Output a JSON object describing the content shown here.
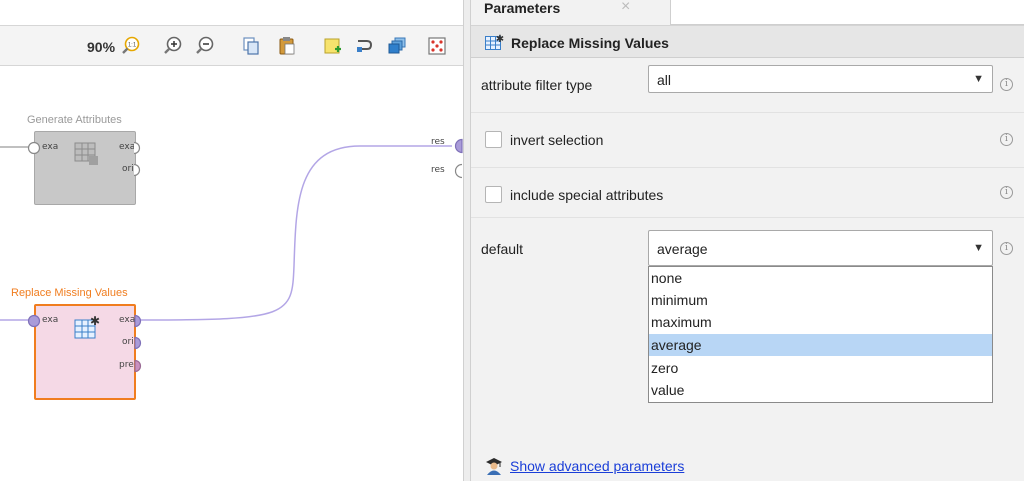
{
  "toolbar": {
    "zoom_level": "90%",
    "icons": [
      "zoom-fit-icon",
      "zoom-in-icon",
      "zoom-out-icon",
      "copy-icon",
      "paste-icon",
      "add-note-icon",
      "connect-icon",
      "layers-icon",
      "arrange-icon"
    ]
  },
  "canvas": {
    "generate_attributes": {
      "title": "Generate Attributes",
      "in_ports": [
        "exa"
      ],
      "out_ports": [
        "exa",
        "ori"
      ]
    },
    "replace_missing_values": {
      "title": "Replace Missing Values",
      "in_ports": [
        "exa"
      ],
      "out_ports": [
        "exa",
        "ori",
        "pre"
      ]
    },
    "result_ports": [
      "res",
      "res"
    ]
  },
  "params_tab": {
    "label": "Parameters",
    "close": "×"
  },
  "operator": {
    "title": "Replace Missing Values"
  },
  "params": {
    "attribute_filter_type": {
      "label": "attribute filter type",
      "value": "all"
    },
    "invert_selection": {
      "label": "invert selection",
      "checked": false
    },
    "include_special_attributes": {
      "label": "include special attributes",
      "checked": false
    },
    "default": {
      "label": "default",
      "value": "average"
    }
  },
  "dropdown": {
    "options": [
      "none",
      "minimum",
      "maximum",
      "average",
      "zero",
      "value"
    ],
    "selected": "average"
  },
  "advanced_link": "Show advanced parameters",
  "info_glyph": "i",
  "colors": {
    "accent_orange": "#f07d1f",
    "wire_purple": "#b3a6e6",
    "selected_blue": "#b8d6f5",
    "link_blue": "#1a3ed8"
  }
}
